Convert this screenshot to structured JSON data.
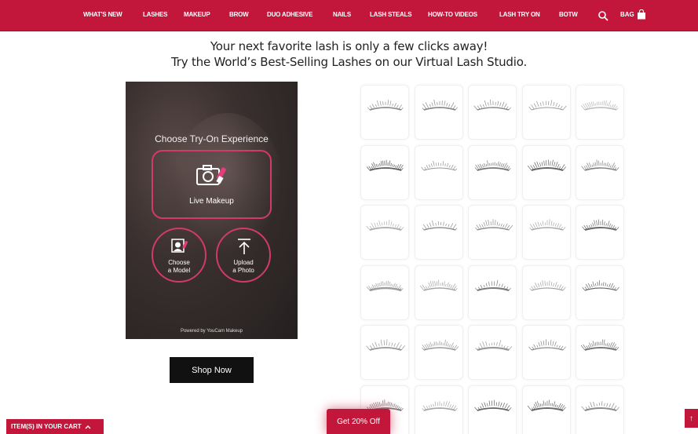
{
  "nav": {
    "items": [
      "WHAT'S NEW",
      "LASHES",
      "MAKEUP",
      "BROW",
      "DUO ADHESIVE",
      "NAILS",
      "LASH STEALS",
      "HOW-TO VIDEOS",
      "LASH TRY ON",
      "BOTW"
    ],
    "bag_label": "BAG"
  },
  "headline": {
    "line1": "Your next favorite lash is only a few clicks away!",
    "line2": "Try the World’s Best-Selling Lashes on our Virtual Lash Studio."
  },
  "tryon": {
    "title": "Choose Try-On Experience",
    "live_label": "Live Makeup",
    "model_label_1": "Choose",
    "model_label_2": "a Model",
    "upload_label_1": "Upload",
    "upload_label_2": "a Photo",
    "powered": "Powered by YouCam Makeup"
  },
  "shop_now": "Shop Now",
  "cart_label": "ITEM(S) IN YOUR CART",
  "promo_label": "Get 20% Off",
  "scroll_top_label": "↑",
  "colors": {
    "brand": "#c2163a",
    "accent_ring": "#d23a6a"
  }
}
